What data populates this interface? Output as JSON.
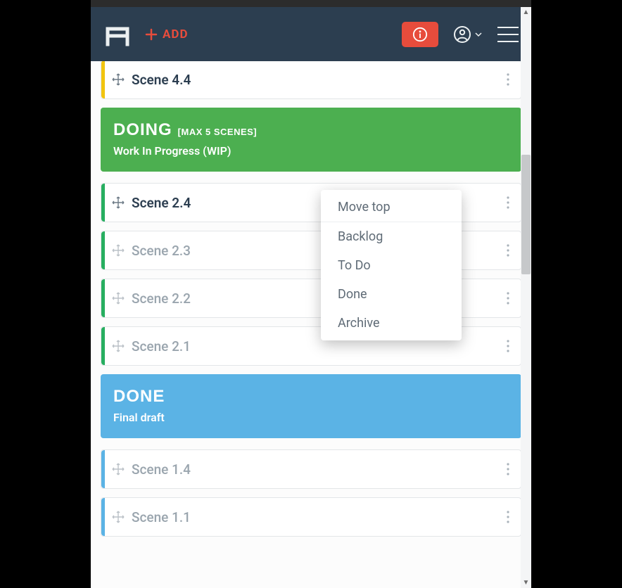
{
  "nav": {
    "add_label": "ADD"
  },
  "popup": {
    "items": [
      "Move top",
      "Backlog",
      "To Do",
      "Done",
      "Archive"
    ]
  },
  "top_card": {
    "title": "Scene 4.4"
  },
  "sections": [
    {
      "id": "doing",
      "color": "green",
      "title": "DOING",
      "note": "[MAX 5 SCENES]",
      "subtitle": "Work In Progress (WIP)",
      "cards": [
        {
          "title": "Scene 2.4",
          "active": true
        },
        {
          "title": "Scene 2.3",
          "active": false
        },
        {
          "title": "Scene 2.2",
          "active": false
        },
        {
          "title": "Scene 2.1",
          "active": false
        }
      ]
    },
    {
      "id": "done",
      "color": "blue",
      "title": "DONE",
      "note": "",
      "subtitle": "Final draft",
      "cards": [
        {
          "title": "Scene 1.4",
          "active": false
        },
        {
          "title": "Scene 1.1",
          "active": false
        }
      ]
    }
  ]
}
